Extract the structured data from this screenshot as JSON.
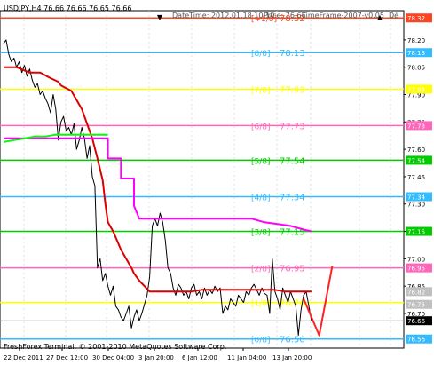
{
  "header": {
    "symbol_info": "USDJPY,H4  76.66 76.66 76.65 76.66",
    "date_time": "DateTime: 2012.01.18 10:10",
    "price": "Price: 76.66",
    "timeframe": "TimeFrame-2007-v0.05",
    "de_label": "Dé"
  },
  "footer": {
    "copyright": "FreshForex Terminal, © 2001-2010 MetaQuotes Software Corp."
  },
  "chart_data": {
    "type": "line",
    "ylim": [
      76.51,
      78.36
    ],
    "y_ticks": [
      "78.20",
      "78.05",
      "77.90",
      "77.75",
      "77.60",
      "77.45",
      "77.30",
      "77.15",
      "77.00",
      "76.85",
      "76.70"
    ],
    "x_tick_labels": [
      "22 Dec 2011",
      "27 Dec 12:00",
      "30 Dec 04:00",
      "3 Jan 20:00",
      "6 Jan 12:00",
      "11 Jan 04:00",
      "13 Jan 20:00"
    ],
    "murrey_levels": [
      {
        "label": "[+1/8]",
        "value": "78.32",
        "color": "#ff4422",
        "axis_label": "78.32"
      },
      {
        "label": "[8/8]",
        "value": "78.13",
        "color": "#33bbff",
        "axis_label": "78.13"
      },
      {
        "label": "[7/8]",
        "value": "77.93",
        "color": "#ffff00",
        "axis_label": "77.93"
      },
      {
        "label": "[6/8]",
        "value": "77.73",
        "color": "#ff66bb",
        "axis_label": "77.73"
      },
      {
        "label": "[5/8]",
        "value": "77.54",
        "color": "#00cc00",
        "axis_label": "77.54"
      },
      {
        "label": "[4/8]",
        "value": "77.34",
        "color": "#33bbff",
        "axis_label": "77.34"
      },
      {
        "label": "[3/8]",
        "value": "77.15",
        "color": "#00cc00",
        "axis_label": "77.15"
      },
      {
        "label": "[2/8]",
        "value": "76.95",
        "color": "#ff66bb",
        "axis_label": "76.95"
      },
      {
        "label": "[1/8]",
        "value": "76.76",
        "color": "#ffff00",
        "axis_label": ""
      },
      {
        "label": "[0/8]",
        "value": "76.56",
        "color": "#33bbff",
        "axis_label": "76.56"
      }
    ],
    "current_price_label": "76.66",
    "extra_axis_labels": [
      "76.82",
      "76.75"
    ],
    "series": [
      {
        "kind": "price",
        "color": "#000000",
        "x": [
          0,
          3,
          6,
          9,
          12,
          15,
          18,
          21,
          24,
          27,
          30,
          33,
          36,
          39,
          42,
          45,
          48,
          51,
          54,
          57,
          60,
          63,
          66,
          69,
          72,
          75,
          78,
          81,
          84,
          87,
          90,
          93,
          96,
          99,
          102,
          105,
          108,
          111,
          114,
          117,
          120,
          123,
          126,
          129,
          132,
          135,
          138,
          141,
          144,
          147,
          150,
          153,
          156,
          159,
          162,
          165,
          168,
          171,
          174,
          177,
          180,
          183,
          186,
          189,
          192,
          195,
          198,
          201,
          204,
          207,
          210,
          213,
          216,
          219,
          222,
          225,
          228,
          231,
          234,
          237,
          240,
          243,
          246,
          249,
          252,
          255,
          258,
          261,
          264,
          267,
          270,
          273,
          276,
          279,
          282,
          285,
          288,
          291,
          294,
          297,
          300,
          303,
          306,
          309,
          312,
          315,
          318,
          321,
          324,
          327,
          330,
          333,
          336,
          339,
          342,
          345,
          348,
          351,
          354
        ],
        "y": [
          78.18,
          78.2,
          78.12,
          78.08,
          78.1,
          78.05,
          78.08,
          78.02,
          78.06,
          78.0,
          78.04,
          77.98,
          77.94,
          77.96,
          77.9,
          77.92,
          77.88,
          77.85,
          77.8,
          77.9,
          77.82,
          77.65,
          77.75,
          77.78,
          77.7,
          77.72,
          77.68,
          77.74,
          77.6,
          77.65,
          77.72,
          77.66,
          77.55,
          77.62,
          77.45,
          77.4,
          76.95,
          77.0,
          76.88,
          76.92,
          76.85,
          76.8,
          76.85,
          76.74,
          76.72,
          76.68,
          76.66,
          76.7,
          76.74,
          76.62,
          76.68,
          76.72,
          76.66,
          76.7,
          76.75,
          76.8,
          76.9,
          77.18,
          77.22,
          77.18,
          77.25,
          77.2,
          77.1,
          76.95,
          76.92,
          76.84,
          76.8,
          76.86,
          76.84,
          76.8,
          76.82,
          76.78,
          76.84,
          76.86,
          76.8,
          76.82,
          76.78,
          76.84,
          76.8,
          76.83,
          76.81,
          76.85,
          76.82,
          76.84,
          76.7,
          76.74,
          76.72,
          76.78,
          76.76,
          76.74,
          76.8,
          76.78,
          76.76,
          76.82,
          76.8,
          76.84,
          76.86,
          76.83,
          76.8,
          76.84,
          76.81,
          76.8,
          76.7,
          77.0,
          76.82,
          76.78,
          76.72,
          76.84,
          76.8,
          76.76,
          76.82,
          76.78,
          76.74,
          76.58,
          76.72,
          76.8,
          76.82,
          76.74,
          76.66
        ]
      },
      {
        "kind": "red_line",
        "color": "#dd0000",
        "x": [
          0,
          15,
          30,
          42,
          54,
          63,
          66,
          78,
          84,
          90,
          96,
          102,
          108,
          114,
          117,
          120,
          126,
          135,
          141,
          147,
          150,
          156,
          162,
          168,
          174,
          180,
          186,
          192,
          204,
          216,
          228,
          240,
          252,
          264,
          276,
          288,
          300,
          312,
          324,
          336,
          342,
          354
        ],
        "y": [
          78.05,
          78.05,
          78.02,
          78.02,
          77.99,
          77.97,
          77.95,
          77.92,
          77.87,
          77.82,
          77.74,
          77.66,
          77.55,
          77.43,
          77.3,
          77.2,
          77.15,
          77.05,
          77.0,
          76.95,
          76.92,
          76.88,
          76.85,
          76.82,
          76.82,
          76.82,
          76.82,
          76.82,
          76.82,
          76.82,
          76.83,
          76.83,
          76.83,
          76.83,
          76.83,
          76.83,
          76.83,
          76.83,
          76.82,
          76.82,
          76.82,
          76.82
        ]
      },
      {
        "kind": "magenta_line",
        "color": "#ff00ff",
        "x": [
          0,
          120,
          120,
          135,
          135,
          150,
          150,
          156,
          162,
          162,
          180,
          195,
          210,
          225,
          240,
          255,
          270,
          285,
          300,
          315,
          330,
          345,
          354
        ],
        "y": [
          77.66,
          77.66,
          77.55,
          77.55,
          77.44,
          77.44,
          77.29,
          77.22,
          77.22,
          77.22,
          77.22,
          77.22,
          77.22,
          77.22,
          77.22,
          77.22,
          77.22,
          77.22,
          77.2,
          77.19,
          77.18,
          77.16,
          77.15
        ]
      },
      {
        "kind": "green_line",
        "color": "#00ff00",
        "x": [
          0,
          12,
          24,
          36,
          48,
          60,
          72,
          84,
          96,
          108,
          120
        ],
        "y": [
          77.64,
          77.65,
          77.66,
          77.67,
          77.67,
          77.68,
          77.68,
          77.68,
          77.68,
          77.68,
          77.68
        ]
      },
      {
        "kind": "red_projection",
        "color": "#ff2222",
        "x": [
          345,
          354,
          363,
          378
        ],
        "y": [
          76.78,
          76.68,
          76.58,
          76.96
        ]
      }
    ]
  }
}
